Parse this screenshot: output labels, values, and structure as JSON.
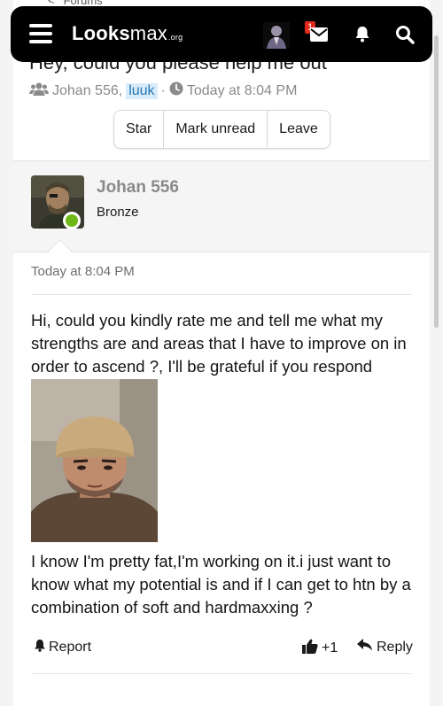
{
  "breadcrumb": {
    "label": "Forums"
  },
  "nav": {
    "logo_main": "Looks",
    "logo_rest": "max",
    "logo_suffix": ".org",
    "mail_badge": "1"
  },
  "thread": {
    "title": "Hey, could you please help me out"
  },
  "meta": {
    "author": "Johan 556,",
    "participant": "luuk",
    "separator": "·",
    "time": "Today at 8:04 PM"
  },
  "actions": {
    "star": "Star",
    "mark_unread": "Mark unread",
    "leave": "Leave"
  },
  "post": {
    "username": "Johan 556",
    "user_title": "Bronze",
    "date": "Today at 8:04 PM",
    "paragraph1": "Hi, could you kindly rate me and tell me what my strengths are and areas that I have to improve on in order to ascend ?, I'll be grateful if you respond",
    "paragraph2": "I know I'm pretty fat,I'm working on it.i just want to know what my potential is and if I can get to htn by a combination of soft and hardmaxxing ?",
    "report_label": "Report",
    "like_label": "+1",
    "reply_label": "Reply"
  },
  "icons": {
    "menu": "hamburger-icon",
    "mail": "envelope-icon",
    "bell": "bell-icon",
    "search": "search-icon",
    "users": "users-icon",
    "clock": "clock-icon",
    "report": "bell-icon",
    "like": "thumbs-up-icon",
    "reply": "reply-icon"
  },
  "colors": {
    "navbar": "#000000",
    "badge": "#e0291c",
    "online": "#6fb617",
    "highlight_bg": "#d8ecfb",
    "highlight_text": "#2577b1"
  }
}
